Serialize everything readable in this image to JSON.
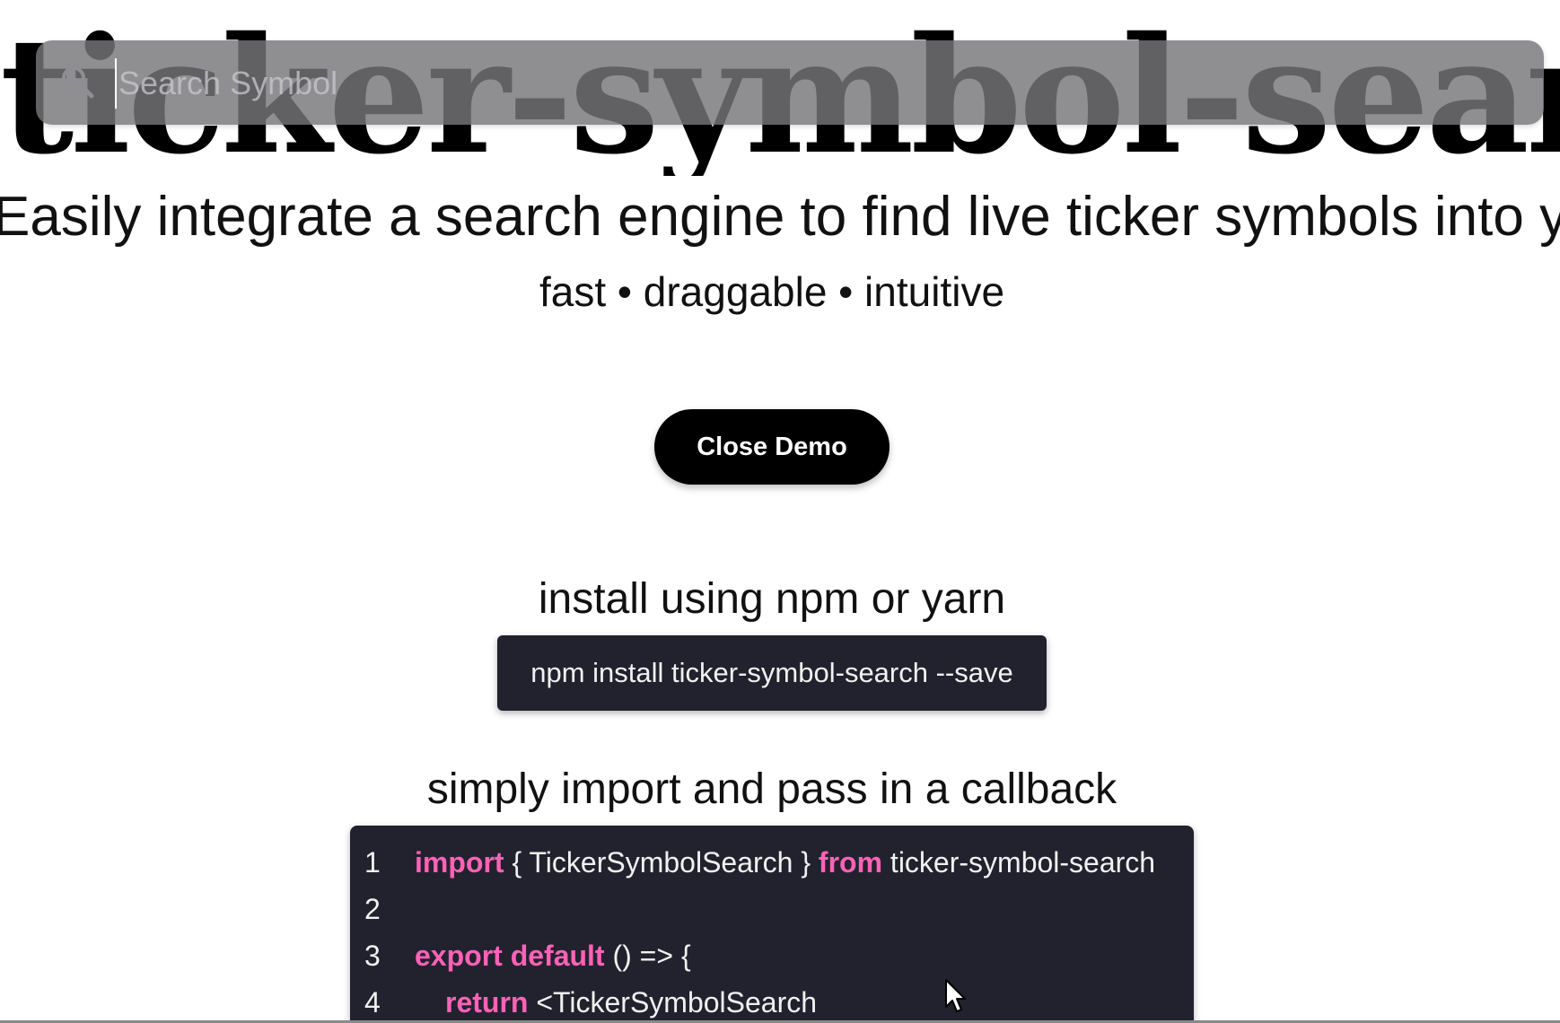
{
  "hero": {
    "title": "ticker-symbol-search",
    "subtitle": "Easily integrate a search engine to find live ticker symbols into your app",
    "features": "fast • draggable • intuitive"
  },
  "search": {
    "placeholder": "Search Symbol",
    "value": "",
    "icon": "search-icon"
  },
  "demo": {
    "close_label": "Close Demo"
  },
  "install": {
    "heading": "install using npm or yarn",
    "command": "npm install ticker-symbol-search --save"
  },
  "usage": {
    "heading": "simply import and pass in a callback",
    "lines": [
      {
        "num": "1",
        "kw1": "import",
        "t1": " { TickerSymbolSearch } ",
        "kw2": "from",
        "t2": " ticker-symbol-search"
      },
      {
        "num": "2"
      },
      {
        "num": "3",
        "kw1": "export default",
        "t1": " () => {"
      },
      {
        "num": "4",
        "kw1": "return",
        "t1": " <TickerSymbolSearch"
      }
    ]
  },
  "colors": {
    "keyword": "#ff62b7",
    "code_bg": "#22222e",
    "button_bg": "#000000"
  }
}
